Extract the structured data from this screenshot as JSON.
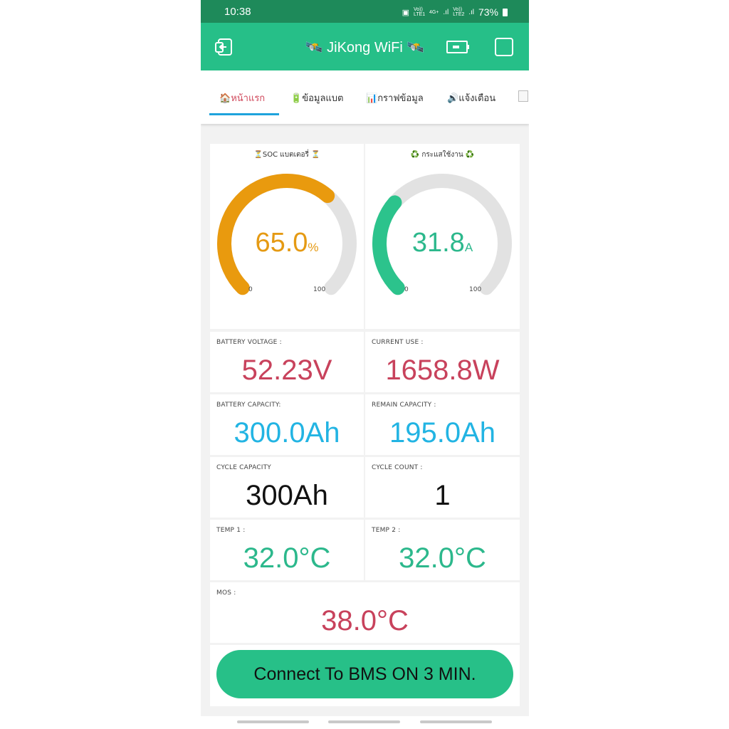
{
  "status": {
    "time": "10:38",
    "net1": "Vo)) LTE1",
    "net2": "4G+",
    "net3": "Vo)) LTE2",
    "battery": "73%"
  },
  "app": {
    "title_icon_left": "🛰️",
    "title": "JiKong WiFi",
    "title_icon_right": "🛰️"
  },
  "tabs": [
    {
      "icon": "🏠",
      "label": "หน้าแรก"
    },
    {
      "icon": "🔋",
      "label": "ข้อมูลแบต"
    },
    {
      "icon": "📊",
      "label": "กราฟข้อมูล"
    },
    {
      "icon": "🔊",
      "label": "แจ้งเตือน"
    }
  ],
  "gauges": {
    "soc": {
      "title": "⏳SOC แบตเตอรี่ ⏳",
      "value": "65.0",
      "unit": "%",
      "fraction": 0.65,
      "min": "0",
      "max": "100",
      "color": "#e99a0e"
    },
    "current": {
      "title": "♻️ กระแสใช้งาน ♻️",
      "value": "31.8",
      "unit": "A",
      "fraction": 0.318,
      "min": "0",
      "max": "100",
      "color": "#2cc38c"
    }
  },
  "stats": {
    "battery_voltage": {
      "label": "BATTERY VOLTAGE :",
      "value": "52.23V"
    },
    "current_use": {
      "label": "CURRENT USE :",
      "value": "1658.8W"
    },
    "battery_capacity": {
      "label": "BATTERY CAPACITY:",
      "value": "300.0Ah"
    },
    "remain_capacity": {
      "label": "REMAIN CAPACITY :",
      "value": "195.0Ah"
    },
    "cycle_capacity": {
      "label": "CYCLE CAPACITY",
      "value": "300Ah"
    },
    "cycle_count": {
      "label": "CYCLE COUNT :",
      "value": "1"
    },
    "temp1": {
      "label": "TEMP 1 :",
      "value": "32.0°C"
    },
    "temp2": {
      "label": "TEMP 2 :",
      "value": "32.0°C"
    },
    "mos": {
      "label": "MOS :",
      "value": "38.0°C"
    }
  },
  "connect_button": "Connect To BMS ON 3 MIN.",
  "colors": {
    "statusbar": "#1e8a5a",
    "appbar": "#26bf88",
    "track": "#e2e2e2"
  }
}
